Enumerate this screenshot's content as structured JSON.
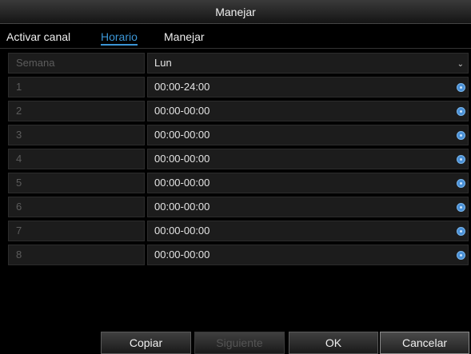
{
  "window": {
    "title": "Manejar"
  },
  "tabs": [
    {
      "label": "Activar canal"
    },
    {
      "label": "Horario",
      "active": true
    },
    {
      "label": "Manejar"
    }
  ],
  "schedule": {
    "week_label": "Semana",
    "week_value": "Lun",
    "periods": [
      {
        "label": "1",
        "value": "00:00-24:00"
      },
      {
        "label": "2",
        "value": "00:00-00:00"
      },
      {
        "label": "3",
        "value": "00:00-00:00"
      },
      {
        "label": "4",
        "value": "00:00-00:00"
      },
      {
        "label": "5",
        "value": "00:00-00:00"
      },
      {
        "label": "6",
        "value": "00:00-00:00"
      },
      {
        "label": "7",
        "value": "00:00-00:00"
      },
      {
        "label": "8",
        "value": "00:00-00:00"
      }
    ]
  },
  "buttons": {
    "copy": "Copiar",
    "next": "Siguiente",
    "ok": "OK",
    "cancel": "Cancelar"
  },
  "icons": {
    "period_icon": "clock-icon",
    "dropdown_icon": "chevron-down-icon"
  },
  "colors": {
    "accent": "#3b96d6",
    "background": "#000000",
    "cell": "#1c1c1c"
  }
}
